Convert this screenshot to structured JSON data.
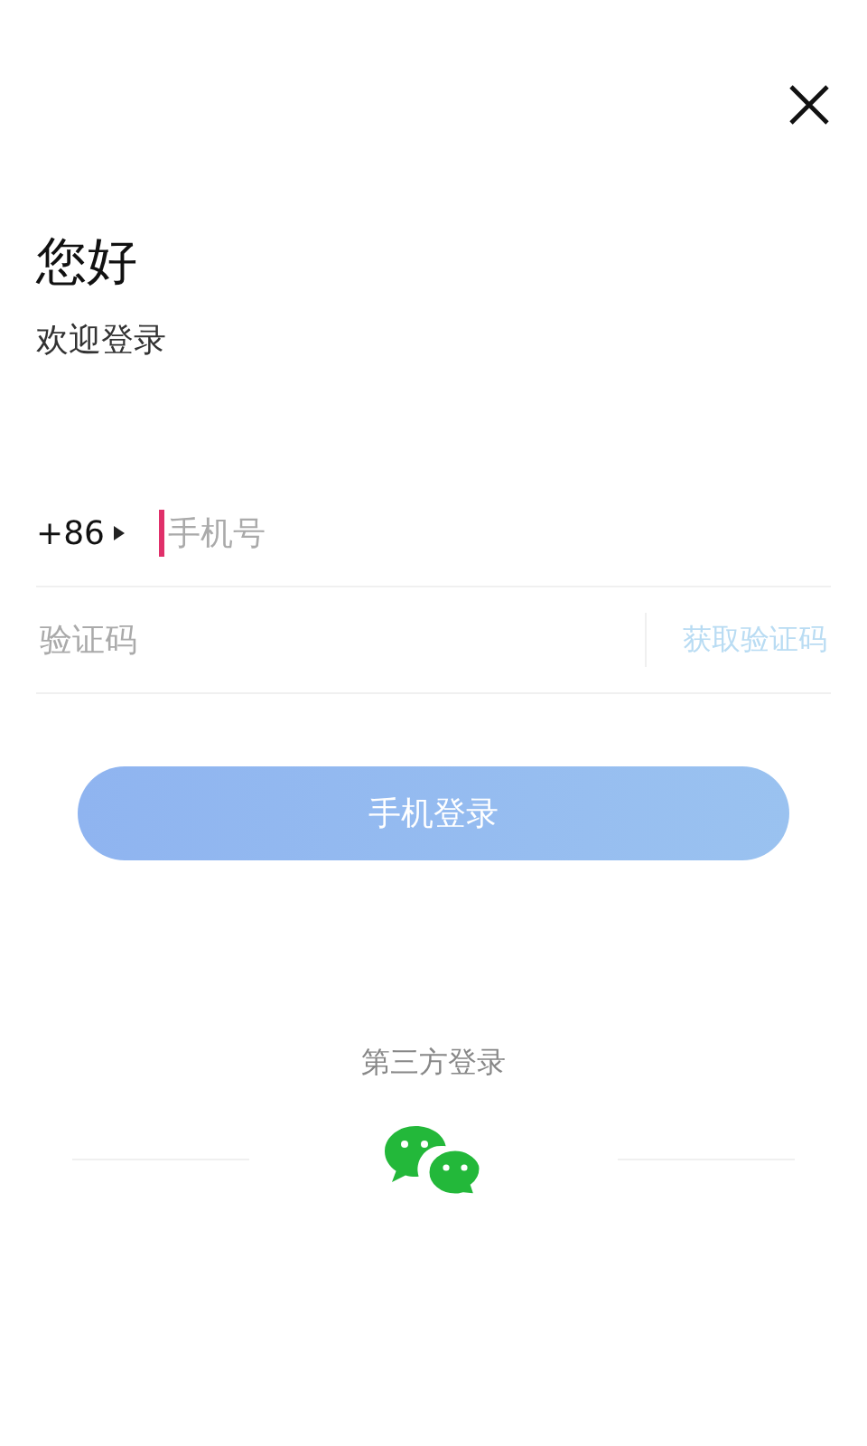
{
  "title": "您好",
  "subtitle": "欢迎登录",
  "phone": {
    "country_code": "+86",
    "placeholder": "手机号",
    "focused": true
  },
  "code": {
    "placeholder": "验证码",
    "get_code": {
      "label": "获取验证码",
      "disabled": true
    }
  },
  "login_button": {
    "label": "手机登录",
    "disabled": true
  },
  "third_party": {
    "label": "第三方登录"
  }
}
